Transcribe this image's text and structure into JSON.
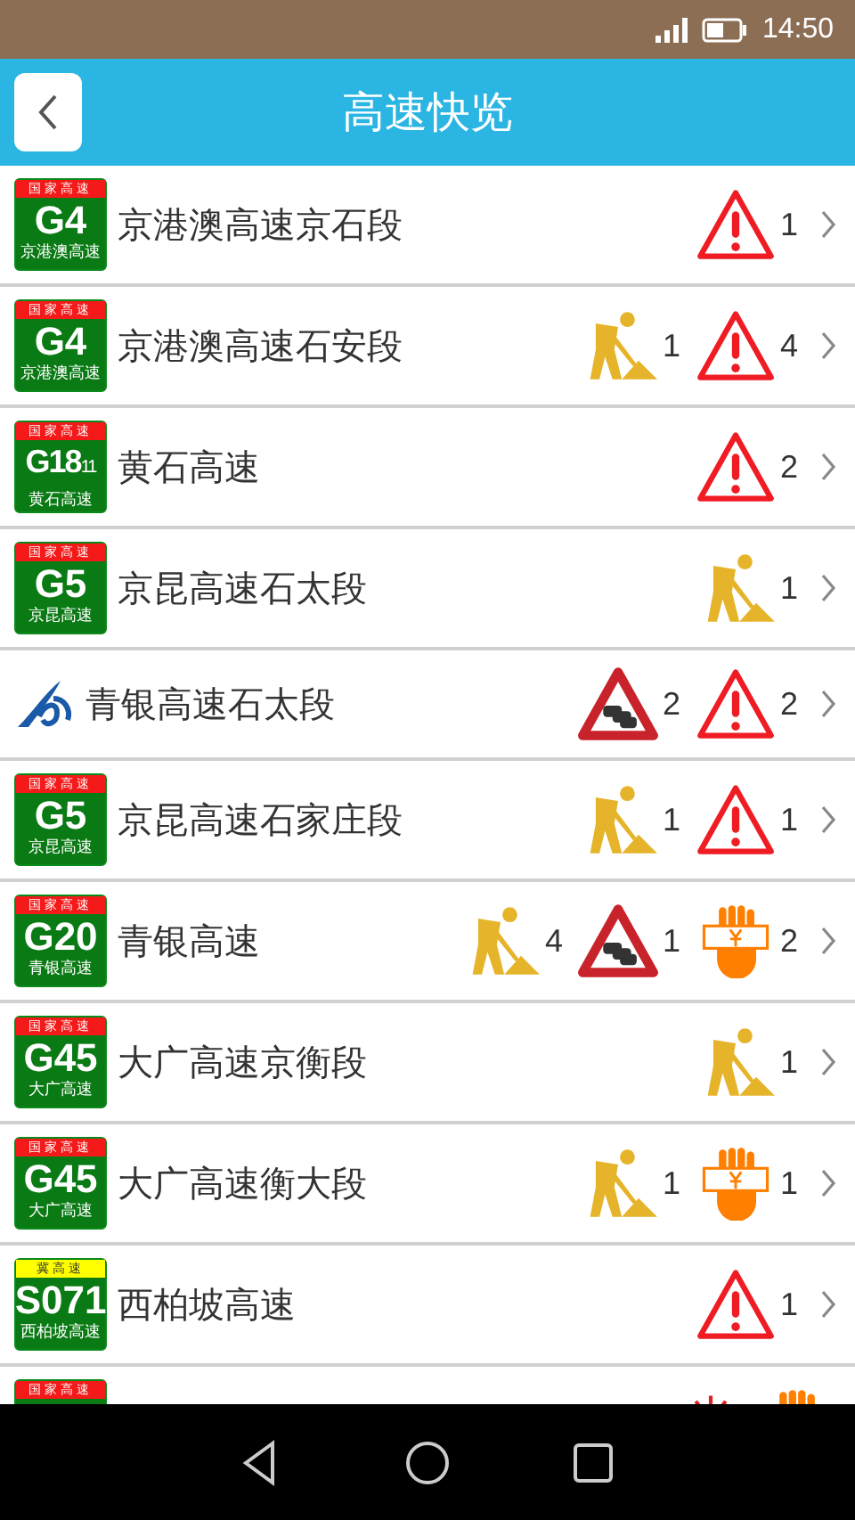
{
  "status_bar": {
    "time": "14:50"
  },
  "header": {
    "title": "高速快览"
  },
  "roads": [
    {
      "badge": {
        "kind": "national",
        "top": "国家高速",
        "code": "G4",
        "name": "京港澳高速"
      },
      "name": "京港澳高速京石段",
      "events": [
        {
          "kind": "warning",
          "count": "1"
        }
      ]
    },
    {
      "badge": {
        "kind": "national",
        "top": "国家高速",
        "code": "G4",
        "name": "京港澳高速"
      },
      "name": "京港澳高速石安段",
      "events": [
        {
          "kind": "construction",
          "count": "1"
        },
        {
          "kind": "warning",
          "count": "4"
        }
      ]
    },
    {
      "badge": {
        "kind": "national",
        "top": "国家高速",
        "code": "G18",
        "suffix": "11",
        "name": "黄石高速"
      },
      "name": "黄石高速",
      "events": [
        {
          "kind": "warning",
          "count": "2"
        }
      ]
    },
    {
      "badge": {
        "kind": "national",
        "top": "国家高速",
        "code": "G5",
        "name": "京昆高速"
      },
      "name": "京昆高速石太段",
      "events": [
        {
          "kind": "construction",
          "count": "1"
        }
      ]
    },
    {
      "badge": {
        "kind": "logo"
      },
      "name": "青银高速石太段",
      "events": [
        {
          "kind": "congestion",
          "count": "2"
        },
        {
          "kind": "warning",
          "count": "2"
        }
      ]
    },
    {
      "badge": {
        "kind": "national",
        "top": "国家高速",
        "code": "G5",
        "name": "京昆高速"
      },
      "name": "京昆高速石家庄段",
      "events": [
        {
          "kind": "construction",
          "count": "1"
        },
        {
          "kind": "warning",
          "count": "1"
        }
      ]
    },
    {
      "badge": {
        "kind": "national",
        "top": "国家高速",
        "code": "G20",
        "name": "青银高速"
      },
      "name": "青银高速",
      "events": [
        {
          "kind": "construction",
          "count": "4"
        },
        {
          "kind": "congestion",
          "count": "1"
        },
        {
          "kind": "toll",
          "count": "2"
        }
      ]
    },
    {
      "badge": {
        "kind": "national",
        "top": "国家高速",
        "code": "G45",
        "name": "大广高速"
      },
      "name": "大广高速京衡段",
      "events": [
        {
          "kind": "construction",
          "count": "1"
        }
      ]
    },
    {
      "badge": {
        "kind": "national",
        "top": "国家高速",
        "code": "G45",
        "name": "大广高速"
      },
      "name": "大广高速衡大段",
      "events": [
        {
          "kind": "construction",
          "count": "1"
        },
        {
          "kind": "toll",
          "count": "1"
        }
      ]
    },
    {
      "badge": {
        "kind": "provincial",
        "top": "冀高速",
        "code": "S071",
        "name": "西柏坡高速"
      },
      "name": "西柏坡高速",
      "events": [
        {
          "kind": "warning",
          "count": "1"
        }
      ]
    },
    {
      "badge": {
        "kind": "national",
        "top": "国家高速"
      },
      "events": [
        {
          "kind": "accident"
        },
        {
          "kind": "toll"
        }
      ]
    }
  ]
}
